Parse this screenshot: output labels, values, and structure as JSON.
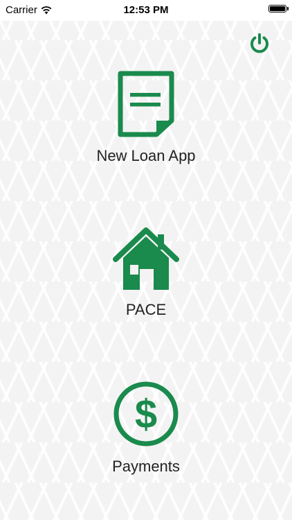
{
  "status_bar": {
    "carrier": "Carrier",
    "time": "12:53 PM",
    "battery_level": 1.0
  },
  "colors": {
    "accent": "#1a8a4d",
    "label": "#222222"
  },
  "header": {
    "power_icon": "power-icon"
  },
  "menu": {
    "items": [
      {
        "label": "New Loan App",
        "icon": "document-icon"
      },
      {
        "label": "PACE",
        "icon": "house-icon"
      },
      {
        "label": "Payments",
        "icon": "dollar-icon"
      }
    ]
  }
}
